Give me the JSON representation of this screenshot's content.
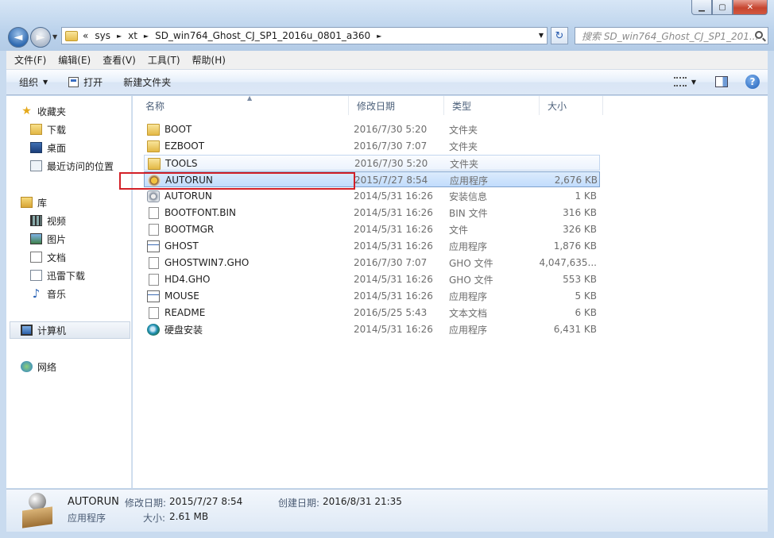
{
  "window": {
    "min_glyph": "▁",
    "max_glyph": "▢",
    "close_glyph": "✕"
  },
  "nav": {
    "back_glyph": "◄",
    "forward_glyph": "►",
    "dropdown_glyph": "▼"
  },
  "address": {
    "chevrons": "«",
    "crumbs": [
      "sys",
      "xt",
      "SD_win764_Ghost_CJ_SP1_2016u_0801_a360"
    ],
    "sep": "►",
    "dropdown_glyph": "▼",
    "refresh_glyph": "↻"
  },
  "search": {
    "placeholder": "搜索 SD_win764_Ghost_CJ_SP1_201..."
  },
  "menu": [
    "文件(F)",
    "编辑(E)",
    "查看(V)",
    "工具(T)",
    "帮助(H)"
  ],
  "toolbar": {
    "organize": "组织",
    "open": "打开",
    "new_folder": "新建文件夹",
    "dd_glyph": "▼",
    "help_glyph": "?"
  },
  "sidebar": {
    "favorites": "收藏夹",
    "downloads": "下载",
    "desktop": "桌面",
    "recent": "最近访问的位置",
    "libraries": "库",
    "videos": "视频",
    "pictures": "图片",
    "documents": "文档",
    "xunlei": "迅雷下载",
    "music": "音乐",
    "computer": "计算机",
    "network": "网络",
    "star_glyph": "★",
    "note_glyph": "♪"
  },
  "columns": {
    "name": "名称",
    "modified": "修改日期",
    "type": "类型",
    "size": "大小",
    "sort_glyph": "▲"
  },
  "files": [
    {
      "name": "BOOT",
      "date": "2016/7/30 5:20",
      "type": "文件夹",
      "size": "",
      "icon": "folder-icon"
    },
    {
      "name": "EZBOOT",
      "date": "2016/7/30 7:07",
      "type": "文件夹",
      "size": "",
      "icon": "folder-icon"
    },
    {
      "name": "TOOLS",
      "date": "2016/7/30 5:20",
      "type": "文件夹",
      "size": "",
      "icon": "folder-icon"
    },
    {
      "name": "AUTORUN",
      "date": "2015/7/27 8:54",
      "type": "应用程序",
      "size": "2,676 KB",
      "icon": "application-icon"
    },
    {
      "name": "AUTORUN",
      "date": "2014/5/31 16:26",
      "type": "安装信息",
      "size": "1 KB",
      "icon": "setup-info-icon"
    },
    {
      "name": "BOOTFONT.BIN",
      "date": "2014/5/31 16:26",
      "type": "BIN 文件",
      "size": "316 KB",
      "icon": "file-icon"
    },
    {
      "name": "BOOTMGR",
      "date": "2014/5/31 16:26",
      "type": "文件",
      "size": "326 KB",
      "icon": "file-icon"
    },
    {
      "name": "GHOST",
      "date": "2014/5/31 16:26",
      "type": "应用程序",
      "size": "1,876 KB",
      "icon": "exe-icon"
    },
    {
      "name": "GHOSTWIN7.GHO",
      "date": "2016/7/30 7:07",
      "type": "GHO 文件",
      "size": "4,047,635...",
      "icon": "file-icon"
    },
    {
      "name": "HD4.GHO",
      "date": "2014/5/31 16:26",
      "type": "GHO 文件",
      "size": "553 KB",
      "icon": "file-icon"
    },
    {
      "name": "MOUSE",
      "date": "2014/5/31 16:26",
      "type": "应用程序",
      "size": "5 KB",
      "icon": "exe-icon"
    },
    {
      "name": "README",
      "date": "2016/5/25 5:43",
      "type": "文本文档",
      "size": "6 KB",
      "icon": "file-icon"
    },
    {
      "name": "硬盘安装",
      "date": "2014/5/31 16:26",
      "type": "应用程序",
      "size": "6,431 KB",
      "icon": "disk-install-icon"
    }
  ],
  "details": {
    "name": "AUTORUN",
    "modified_label": "修改日期:",
    "modified": "2015/7/27 8:54",
    "created_label": "创建日期:",
    "created": "2016/8/31 21:35",
    "type": "应用程序",
    "size_label": "大小:",
    "size": "2.61 MB"
  },
  "colors": {
    "highlight_box": "#d32027",
    "selection": "#c1dcfc",
    "frame": "#c9dbef"
  }
}
